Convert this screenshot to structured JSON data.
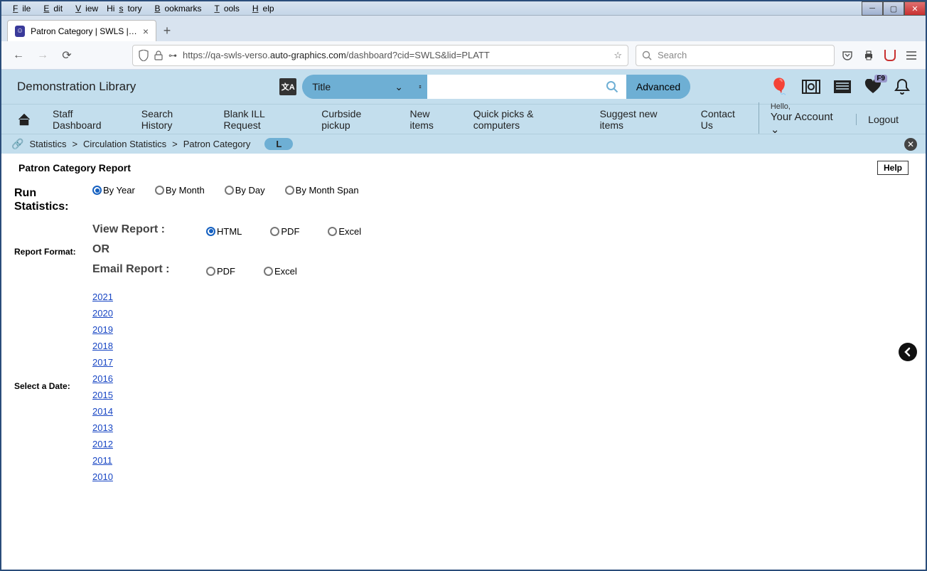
{
  "browser_menu": [
    "File",
    "Edit",
    "View",
    "History",
    "Bookmarks",
    "Tools",
    "Help"
  ],
  "tab": {
    "title": "Patron Category | SWLS | platt |"
  },
  "url": {
    "prefix": "https://qa-swls-verso.",
    "domain": "auto-graphics.com",
    "path": "/dashboard?cid=SWLS&lid=PLATT"
  },
  "search_placeholder": "Search",
  "library_name": "Demonstration Library",
  "search_type": "Title",
  "advanced_label": "Advanced",
  "heart_badge": "F9",
  "nav": {
    "items": [
      "Staff Dashboard",
      "Search History",
      "Blank ILL Request",
      "Curbside pickup",
      "New items",
      "Quick picks & computers",
      "Suggest new items",
      "Contact Us"
    ],
    "hello": "Hello,",
    "account": "Your Account",
    "logout": "Logout"
  },
  "breadcrumb": {
    "parts": [
      "Statistics",
      "Circulation Statistics",
      "Patron Category"
    ],
    "badge": "L"
  },
  "report": {
    "title": "Patron Category Report",
    "help": "Help",
    "run_label": "Run Statistics:",
    "run_options": [
      "By Year",
      "By Month",
      "By Day",
      "By Month Span"
    ],
    "run_selected": "By Year",
    "format_label": "Report Format:",
    "view_heading": "View Report :",
    "or_heading": "OR",
    "email_heading": "Email Report :",
    "view_options": [
      "HTML",
      "PDF",
      "Excel"
    ],
    "view_selected": "HTML",
    "email_options": [
      "PDF",
      "Excel"
    ],
    "date_label": "Select a Date:",
    "dates": [
      "2021",
      "2020",
      "2019",
      "2018",
      "2017",
      "2016",
      "2015",
      "2014",
      "2013",
      "2012",
      "2011",
      "2010"
    ]
  }
}
